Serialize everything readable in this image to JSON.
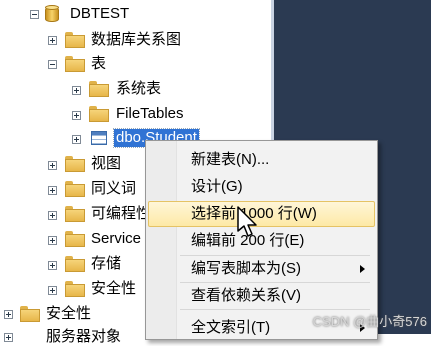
{
  "tree": {
    "database": {
      "label": "DBTEST"
    },
    "items": [
      {
        "label": "数据库关系图"
      },
      {
        "label": "表"
      },
      {
        "label": "系统表"
      },
      {
        "label": "FileTables"
      },
      {
        "label": "dbo.Student"
      },
      {
        "label": "视图"
      },
      {
        "label": "同义词"
      },
      {
        "label": "可编程性"
      },
      {
        "label": "Service Broker"
      },
      {
        "label": "存储"
      },
      {
        "label": "安全性"
      },
      {
        "label": "安全性"
      },
      {
        "label": "服务器对象"
      }
    ]
  },
  "context_menu": {
    "items": [
      {
        "label": "新建表(N)..."
      },
      {
        "label": "设计(G)"
      },
      {
        "label": "选择前 1000 行(W)"
      },
      {
        "label": "编辑前 200 行(E)"
      },
      {
        "label": "编写表脚本为(S)"
      },
      {
        "label": "查看依赖关系(V)"
      },
      {
        "label": "全文索引(T)"
      }
    ]
  },
  "watermark": "CSDN @曲小奇576",
  "colors": {
    "selection": "#3073d4",
    "hover": "#fde9a6",
    "background_right": "#2b3a52"
  }
}
